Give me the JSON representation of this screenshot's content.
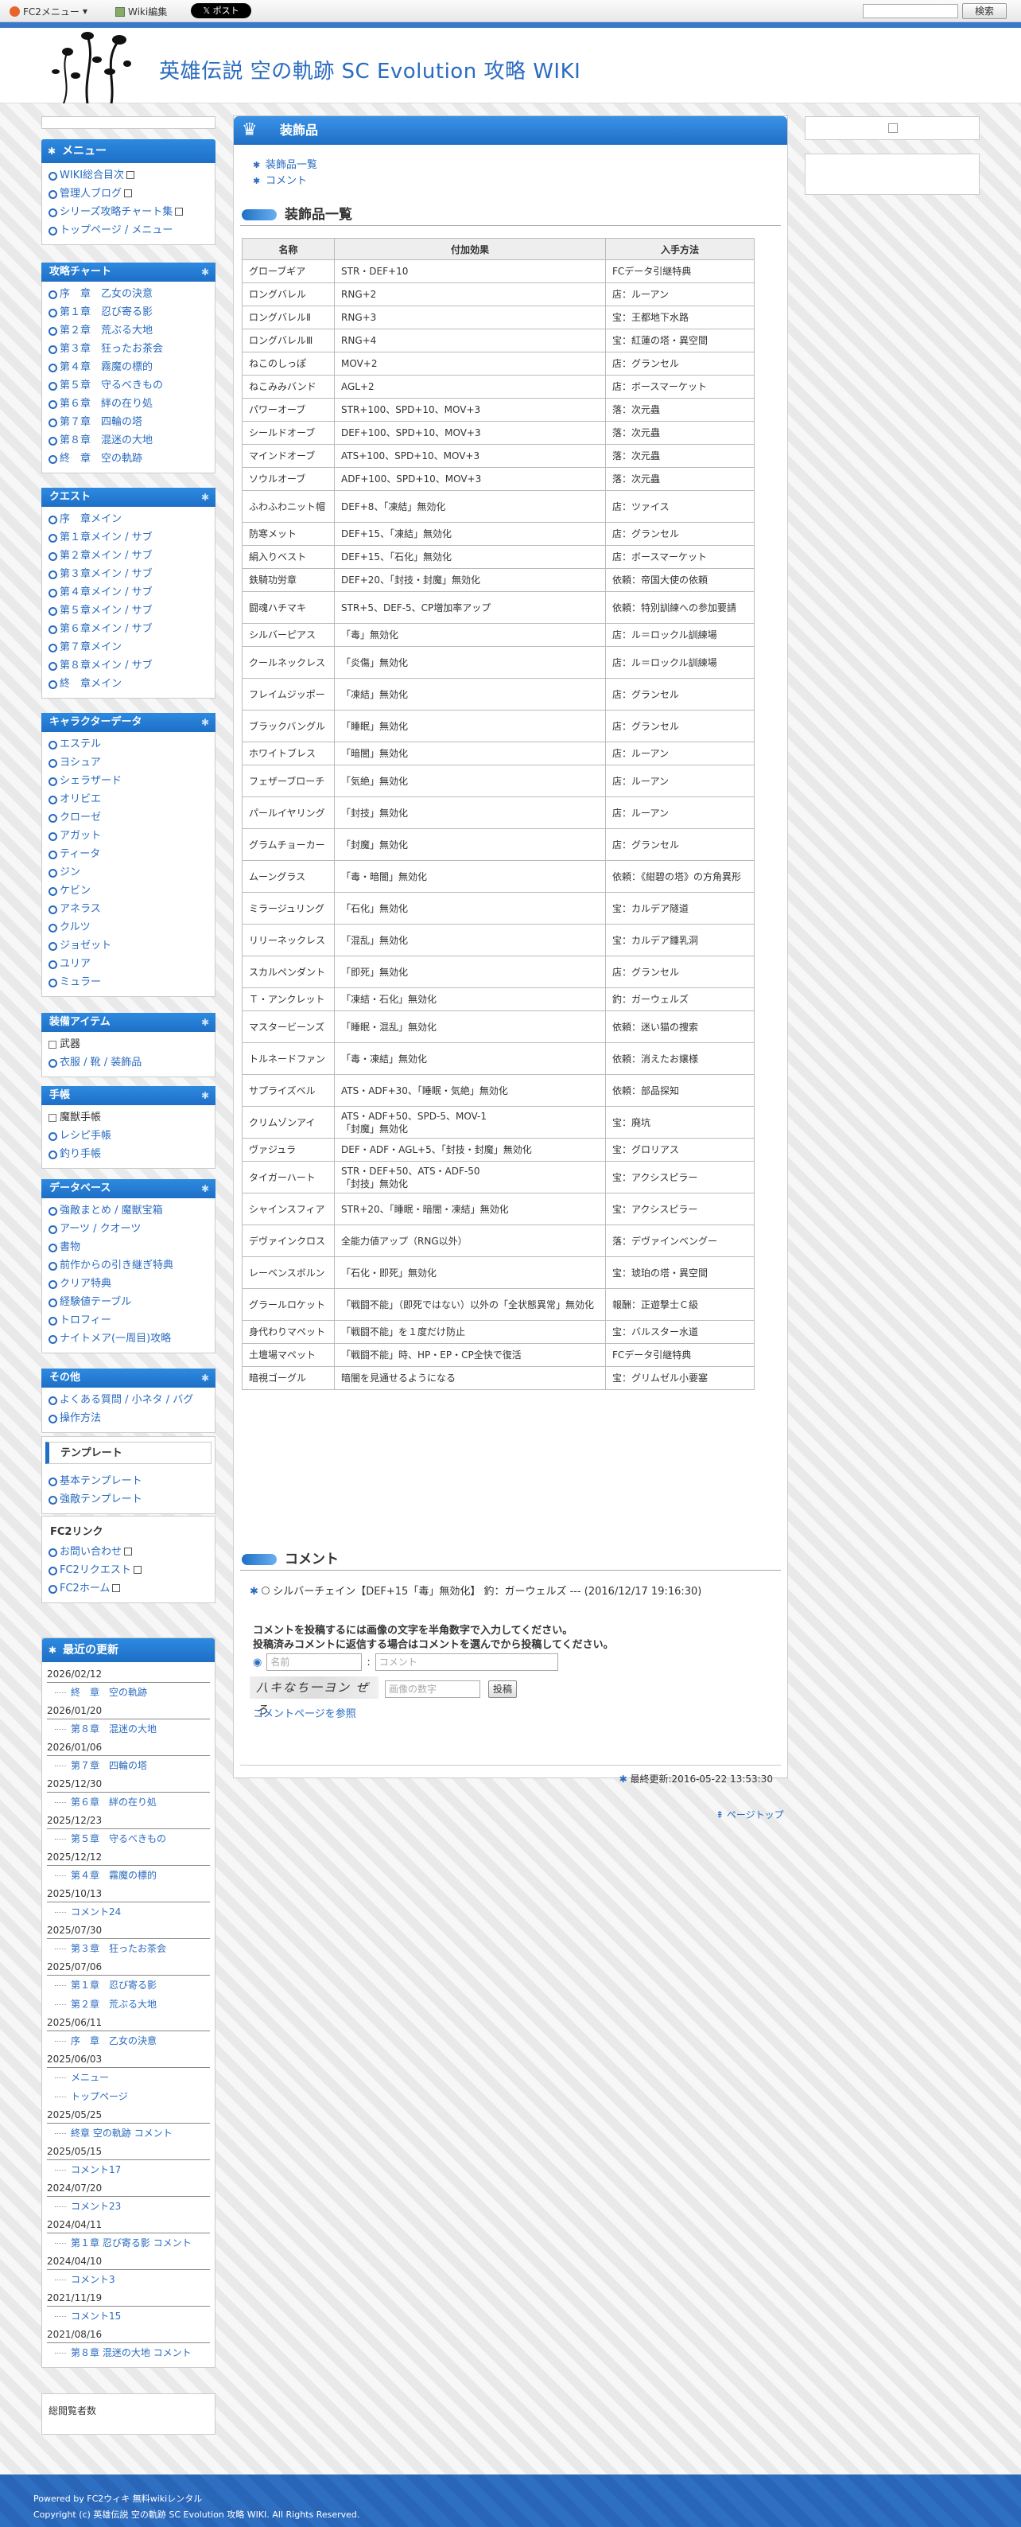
{
  "topbar": {
    "fc2": "FC2メニュー",
    "wiki_edit": "Wiki編集",
    "post": "𝕏 ポスト",
    "search_btn": "検索"
  },
  "header": {
    "title": "英雄伝説 空の軌跡 SC Evolution 攻略 WIKI"
  },
  "menu": {
    "title": "メニュー",
    "items": [
      "WIKI総合目次",
      "管理人ブログ",
      "シリーズ攻略チャート集",
      "トップページ / メニュー"
    ]
  },
  "chart": {
    "title": "攻略チャート",
    "items": [
      "序　章　乙女の決意",
      "第１章　忍び寄る影",
      "第２章　荒ぶる大地",
      "第３章　狂ったお茶会",
      "第４章　霧魔の標的",
      "第５章　守るべきもの",
      "第６章　絆の在り処",
      "第７章　四輪の塔",
      "第８章　混迷の大地",
      "終　章　空の軌跡"
    ]
  },
  "quest": {
    "title": "クエスト",
    "items": [
      "序　章メイン",
      "第１章メイン / サブ",
      "第２章メイン / サブ",
      "第３章メイン / サブ",
      "第４章メイン / サブ",
      "第５章メイン / サブ",
      "第６章メイン / サブ",
      "第７章メイン",
      "第８章メイン / サブ",
      "終　章メイン"
    ]
  },
  "chara": {
    "title": "キャラクターデータ",
    "items": [
      "エステル",
      "ヨシュア",
      "シェラザード",
      "オリビエ",
      "クローゼ",
      "アガット",
      "ティータ",
      "ジン",
      "ケビン",
      "アネラス",
      "クルツ",
      "ジョゼット",
      "ユリア",
      "ミュラー"
    ]
  },
  "equip": {
    "title": "装備アイテム",
    "items": [
      "武器",
      "衣服 / 靴 / 装飾品"
    ]
  },
  "notebook": {
    "title": "手帳",
    "items": [
      "魔獣手帳",
      "レシピ手帳",
      "釣り手帳"
    ]
  },
  "db": {
    "title": "データベース",
    "items": [
      "強敵まとめ / 魔獣宝箱",
      "アーツ / クオーツ",
      "書物",
      "前作からの引き継ぎ特典",
      "クリア特典",
      "経験値テーブル",
      "トロフィー",
      "ナイトメア(一周目)攻略"
    ]
  },
  "other": {
    "title": "その他",
    "items": [
      "よくある質問 / 小ネタ / バグ",
      "操作方法"
    ]
  },
  "template": {
    "title": "テンプレート",
    "items": [
      "基本テンプレート",
      "強敵テンプレート"
    ]
  },
  "fc2link": {
    "title": "FC2リンク",
    "items": [
      "お問い合わせ",
      "FC2リクエスト",
      "FC2ホーム"
    ]
  },
  "updates": {
    "title": "最近の更新",
    "rows": [
      {
        "date": "2026/02/12",
        "entries": [
          "終　章　空の軌跡"
        ]
      },
      {
        "date": "2026/01/20",
        "entries": [
          "第８章　混迷の大地"
        ]
      },
      {
        "date": "2026/01/06",
        "entries": [
          "第７章　四輪の塔"
        ]
      },
      {
        "date": "2025/12/30",
        "entries": [
          "第６章　絆の在り処"
        ]
      },
      {
        "date": "2025/12/23",
        "entries": [
          "第５章　守るべきもの"
        ]
      },
      {
        "date": "2025/12/12",
        "entries": [
          "第４章　霧魔の標的"
        ]
      },
      {
        "date": "2025/10/13",
        "entries": [
          "コメント24"
        ]
      },
      {
        "date": "2025/07/30",
        "entries": [
          "第３章　狂ったお茶会"
        ]
      },
      {
        "date": "2025/07/06",
        "entries": [
          "第１章　忍び寄る影",
          "第２章　荒ぶる大地"
        ]
      },
      {
        "date": "2025/06/11",
        "entries": [
          "序　章　乙女の決意"
        ]
      },
      {
        "date": "2025/06/03",
        "entries": [
          "メニュー",
          "トップページ"
        ]
      },
      {
        "date": "2025/05/25",
        "entries": [
          "終章 空の軌跡 コメント"
        ]
      },
      {
        "date": "2025/05/15",
        "entries": [
          "コメント17"
        ]
      },
      {
        "date": "2024/07/20",
        "entries": [
          "コメント23"
        ]
      },
      {
        "date": "2024/04/11",
        "entries": [
          "第１章 忍び寄る影 コメント"
        ]
      },
      {
        "date": "2024/04/10",
        "entries": [
          "コメント3"
        ]
      },
      {
        "date": "2021/11/19",
        "entries": [
          "コメント15"
        ]
      },
      {
        "date": "2021/08/16",
        "entries": [
          "第８章 混迷の大地 コメント"
        ]
      }
    ]
  },
  "counter": {
    "label": "総閲覧者数"
  },
  "page": {
    "heading": "装飾品",
    "toc": [
      "装飾品一覧",
      "コメント"
    ],
    "section1": "装飾品一覧",
    "section2": "コメント"
  },
  "table": {
    "headers": [
      "名称",
      "付加効果",
      "入手方法"
    ],
    "rows": [
      [
        "グローブギア",
        "STR・DEF+10",
        "FCデータ引継特典"
      ],
      [
        "ロングバレル",
        "RNG+2",
        "店：ルーアン"
      ],
      [
        "ロングバレルⅡ",
        "RNG+3",
        "宝：王都地下水路"
      ],
      [
        "ロングバレルⅢ",
        "RNG+4",
        "宝：紅蓮の塔・異空間"
      ],
      [
        "ねこのしっぽ",
        "MOV+2",
        "店：グランセル"
      ],
      [
        "ねこみみバンド",
        "AGL+2",
        "店：ボースマーケット"
      ],
      [
        "パワーオーブ",
        "STR+100、SPD+10、MOV+3",
        "落：次元蟲"
      ],
      [
        "シールドオーブ",
        "DEF+100、SPD+10、MOV+3",
        "落：次元蟲"
      ],
      [
        "マインドオーブ",
        "ATS+100、SPD+10、MOV+3",
        "落：次元蟲"
      ],
      [
        "ソウルオーブ",
        "ADF+100、SPD+10、MOV+3",
        "落：次元蟲"
      ],
      [
        "ふわふわニット帽",
        "DEF+8、「凍結」無効化",
        "店：ツァイス"
      ],
      [
        "防寒メット",
        "DEF+15、「凍結」無効化",
        "店：グランセル"
      ],
      [
        "絹入りベスト",
        "DEF+15、「石化」無効化",
        "店：ボースマーケット"
      ],
      [
        "鉄騎功労章",
        "DEF+20、「封技・封魔」無効化",
        "依頼：帝国大使の依頼"
      ],
      [
        "闘魂ハチマキ",
        "STR+5、DEF-5、CP増加率アップ",
        "依頼：特別訓練への参加要請"
      ],
      [
        "シルバーピアス",
        "「毒」無効化",
        "店：ル＝ロックル訓練場"
      ],
      [
        "クールネックレス",
        "「炎傷」無効化",
        "店：ル＝ロックル訓練場"
      ],
      [
        "フレイムジッポー",
        "「凍結」無効化",
        "店：グランセル"
      ],
      [
        "ブラックバングル",
        "「睡眠」無効化",
        "店：グランセル"
      ],
      [
        "ホワイトブレス",
        "「暗闇」無効化",
        "店：ルーアン"
      ],
      [
        "フェザーブローチ",
        "「気絶」無効化",
        "店：ルーアン"
      ],
      [
        "パールイヤリング",
        "「封技」無効化",
        "店：ルーアン"
      ],
      [
        "グラムチョーカー",
        "「封魔」無効化",
        "店：グランセル"
      ],
      [
        "ムーングラス",
        "「毒・暗闇」無効化",
        "依頼：《紺碧の塔》の方角異形"
      ],
      [
        "ミラージュリング",
        "「石化」無効化",
        "宝：カルデア隧道"
      ],
      [
        "リリーネックレス",
        "「混乱」無効化",
        "宝：カルデア鍾乳洞"
      ],
      [
        "スカルペンダント",
        "「即死」無効化",
        "店：グランセル"
      ],
      [
        "Ｔ・アンクレット",
        "「凍結・石化」無効化",
        "釣：ガーウェルズ"
      ],
      [
        "マスタービーンズ",
        "「睡眠・混乱」無効化",
        "依頼：迷い猫の捜索"
      ],
      [
        "トルネードファン",
        "「毒・凍結」無効化",
        "依頼：消えたお嬢様"
      ],
      [
        "サプライズベル",
        "ATS・ADF+30、「睡眠・気絶」無効化",
        "依頼：部品探知"
      ],
      [
        "クリムゾンアイ",
        "ATS・ADF+50、SPD-5、MOV-1\n「封魔」無効化",
        "宝：廃坑"
      ],
      [
        "ヴァジュラ",
        "DEF・ADF・AGL+5、「封技・封魔」無効化",
        "宝：グロリアス"
      ],
      [
        "タイガーハート",
        "STR・DEF+50、ATS・ADF-50\n「封技」無効化",
        "宝：アクシスピラー"
      ],
      [
        "シャインスフィア",
        "STR+20、「睡眠・暗闇・凍結」無効化",
        "宝：アクシスピラー"
      ],
      [
        "デヴァインクロス",
        "全能力値アップ（RNG以外）",
        "落：デヴァインベングー"
      ],
      [
        "レーベンスボルン",
        "「石化・即死」無効化",
        "宝：琥珀の塔・異空間"
      ],
      [
        "グラールロケット",
        "「戦闘不能」（即死ではない）以外の「全状態異常」無効化",
        "報酬：正遊撃士Ｃ級"
      ],
      [
        "身代わりマペット",
        "「戦闘不能」を１度だけ防止",
        "宝：バルスター水道"
      ],
      [
        "土壇場マペット",
        "「戦闘不能」時、HP・EP・CP全快で復活",
        "FCデータ引継特典"
      ],
      [
        "暗視ゴーグル",
        "暗闇を見通せるようになる",
        "宝：グリムゼル小要塞"
      ]
    ]
  },
  "comment": {
    "entry": "シルバーチェイン【DEF+15「毒」無効化】 釣：ガーウェルズ --- (2016/12/17 19:16:30)",
    "note1": "コメントを投稿するには画像の文字を半角数字で入力してください。",
    "note2": "投稿済みコメントに返信する場合はコメントを選んでから投稿してください。",
    "name_ph": "名前",
    "comment_ph": "コメント",
    "captcha_text": "八キなち一ヨン  ぜろ",
    "digits_ph": "画像の数字",
    "post": "投稿",
    "ref": "コメントページを参照"
  },
  "last_updated": "最終更新:2016-05-22 13:53:30",
  "pagetop": "ページトップ",
  "footer": {
    "line1": "Powered by FC2ウィキ 無料wikiレンタル",
    "line2": "Copyright (c) 英雄伝説 空の軌跡 SC Evolution 攻略 WIKI. All Rights Reserved."
  }
}
